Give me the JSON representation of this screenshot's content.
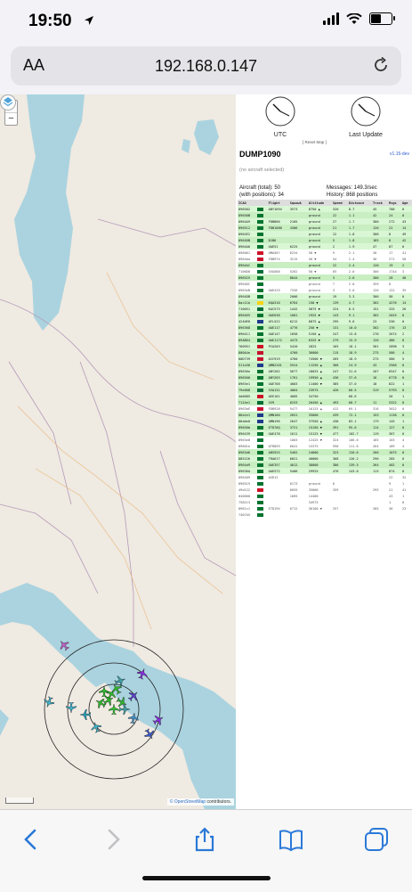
{
  "status_bar": {
    "time": "19:50",
    "battery_level": 0.6
  },
  "address_bar": {
    "aa_label": "AA",
    "url": "192.168.0.147"
  },
  "map": {
    "zoom_in": "+",
    "zoom_out": "−",
    "attribution_osm": "© OpenStreetMap",
    "attribution_rest": "contributors."
  },
  "panel": {
    "clock_utc_label": "UTC",
    "clock_last_update_label": "Last Update",
    "reset_map": "[ Reset Map ]",
    "title": "DUMP1090",
    "version": "v1.15-dev",
    "no_aircraft_selected": "(no aircraft selected)",
    "stats": {
      "aircraft_total": "Aircraft (total): 50",
      "messages": "Messages: 149.3/sec",
      "with_positions": "(with positions): 34",
      "history": "History: 868 positions"
    }
  },
  "table": {
    "headers": [
      "ICAO",
      "",
      "Flight",
      "Squawk",
      "Altitude",
      "Speed",
      "Distance",
      "Track",
      "Msgs",
      "Age"
    ],
    "flag_colors": [
      "#006c35",
      "#ce1126",
      "#00732f",
      "#c8102e",
      "#f7d417",
      "#1e3a8a"
    ],
    "rows": [
      {
        "icao": "896502",
        "flag": 2,
        "flight": "ABY1694",
        "squawk": "3573",
        "alt": "8750 ▲",
        "spd": "320",
        "dist": "8.7",
        "trk": "45",
        "msgs": "788",
        "age": "0",
        "pos": true
      },
      {
        "icao": "89650B",
        "flag": 2,
        "flight": "",
        "squawk": "",
        "alt": "ground",
        "spd": "22",
        "dist": "1.1",
        "trk": "42",
        "msgs": "24",
        "age": "0",
        "pos": true
      },
      {
        "icao": "8964A9",
        "flag": 2,
        "flight": "FDB866",
        "squawk": "2105",
        "alt": "ground",
        "spd": "27",
        "dist": "1.7",
        "trk": "300",
        "msgs": "272",
        "age": "43",
        "pos": true
      },
      {
        "icao": "896512",
        "flag": 2,
        "flight": "FDB1080",
        "squawk": "4306",
        "alt": "ground",
        "spd": "21",
        "dist": "1.7",
        "trk": "120",
        "msgs": "22",
        "age": "14",
        "pos": true
      },
      {
        "icao": "8964E2",
        "flag": 2,
        "flight": "",
        "squawk": "",
        "alt": "ground",
        "spd": "12",
        "dist": "1.8",
        "trk": "308",
        "msgs": "8",
        "age": "49",
        "pos": true
      },
      {
        "icao": "8964DB",
        "flag": 2,
        "flight": "BJ86",
        "squawk": "",
        "alt": "ground",
        "spd": "5",
        "dist": "1.8",
        "trk": "185",
        "msgs": "8",
        "age": "42",
        "pos": true
      },
      {
        "icao": "8964A6",
        "flag": 2,
        "flight": "UAE51",
        "squawk": "6225",
        "alt": "ground",
        "spd": "2",
        "dist": "1.9",
        "trk": "47",
        "msgs": "87",
        "age": "0",
        "pos": true
      },
      {
        "icao": "896061",
        "flag": 1,
        "flight": "OMA507",
        "squawk": "6234",
        "alt": "50 ▼",
        "spd": "9",
        "dist": "2.1",
        "trk": "30",
        "msgs": "17",
        "age": "41",
        "pos": false
      },
      {
        "icao": "8964ba",
        "flag": 3,
        "flight": "FDB974",
        "squawk": "3215",
        "alt": "50 ▼",
        "spd": "54",
        "dist": "2.4",
        "trk": "30",
        "msgs": "271",
        "age": "58",
        "pos": false
      },
      {
        "icao": "8964AC",
        "flag": 2,
        "flight": "",
        "squawk": "",
        "alt": "ground",
        "spd": "22",
        "dist": "2.4",
        "trk": "120",
        "msgs": "19",
        "age": "2",
        "pos": true
      },
      {
        "icao": "7106D8",
        "flag": 0,
        "flight": "SVA568",
        "squawk": "5262",
        "alt": "50 ▼",
        "spd": "65",
        "dist": "2.6",
        "trk": "300",
        "msgs": "1744",
        "age": "3",
        "pos": false
      },
      {
        "icao": "896525",
        "flag": 2,
        "flight": "",
        "squawk": "8044",
        "alt": "ground",
        "spd": "3",
        "dist": "2.6",
        "trk": "300",
        "msgs": "28",
        "age": "48",
        "pos": true
      },
      {
        "icao": "8964DC",
        "flag": 2,
        "flight": "",
        "squawk": "",
        "alt": "ground",
        "spd": "7",
        "dist": "2.8",
        "trk": "359",
        "msgs": "8",
        "age": "",
        "pos": false
      },
      {
        "icao": "8963eB",
        "flag": 2,
        "flight": "UAE419",
        "squawk": "7336",
        "alt": "ground",
        "spd": "3",
        "dist": "3.0",
        "trk": "120",
        "msgs": "122",
        "age": "35",
        "pos": false
      },
      {
        "icao": "8964DB",
        "flag": 2,
        "flight": "",
        "squawk": "2006",
        "alt": "ground",
        "spd": "19",
        "dist": "3.3",
        "trk": "300",
        "msgs": "58",
        "age": "0",
        "pos": true
      },
      {
        "icao": "8ac11b",
        "flag": 4,
        "flight": "KQA310",
        "squawk": "6764",
        "alt": "150 ▼",
        "spd": "139",
        "dist": "4.7",
        "trk": "302",
        "msgs": "4276",
        "age": "14",
        "pos": true
      },
      {
        "icao": "710051",
        "flag": 0,
        "flight": "KAC573",
        "squawk": "1442",
        "alt": "5875 ▼",
        "spd": "224",
        "dist": "8.5",
        "trk": "151",
        "msgs": "325",
        "age": "26",
        "pos": true
      },
      {
        "icao": "8964D5",
        "flag": 2,
        "flight": "UAE638",
        "squawk": "1001",
        "alt": "1925 ▼",
        "spd": "143",
        "dist": "9.1",
        "trk": "302",
        "msgs": "2025",
        "age": "0",
        "pos": true
      },
      {
        "icao": "4240E8",
        "flag": 5,
        "flight": "AFL522",
        "squawk": "6212",
        "alt": "6875 ▲",
        "spd": "295",
        "dist": "9.6",
        "trk": "23",
        "msgs": "536",
        "age": "0",
        "pos": true
      },
      {
        "icao": "89636D",
        "flag": 2,
        "flight": "UAE117",
        "squawk": "4776",
        "alt": "250 ▼",
        "spd": "131",
        "dist": "10.0",
        "trk": "302",
        "msgs": "176",
        "age": "13",
        "pos": true
      },
      {
        "icao": "896411",
        "flag": 2,
        "flight": "UAE147",
        "squawk": "1658",
        "alt": "5150 ▲",
        "spd": "247",
        "dist": "13.8",
        "trk": "270",
        "msgs": "2674",
        "age": "2",
        "pos": true
      },
      {
        "icao": "89ABD4",
        "flag": 2,
        "flight": "UAE1172",
        "squawk": "4473",
        "alt": "6325 ▼",
        "spd": "279",
        "dist": "15.9",
        "trk": "120",
        "msgs": "486",
        "age": "0",
        "pos": true
      },
      {
        "icao": "760951",
        "flag": 1,
        "flight": "PIA203",
        "squawk": "5420",
        "alt": "2825",
        "spd": "165",
        "dist": "18.1",
        "trk": "301",
        "msgs": "2898",
        "age": "3",
        "pos": true
      },
      {
        "icao": "800A4e",
        "flag": 3,
        "flight": "",
        "squawk": "4760",
        "alt": "36000",
        "spd": "115",
        "dist": "18.9",
        "trk": "275",
        "msgs": "586",
        "age": "4",
        "pos": true
      },
      {
        "icao": "80D739",
        "flag": 3,
        "flight": "AIC919",
        "squawk": "4760",
        "alt": "74500 ▼",
        "spd": "265",
        "dist": "18.9",
        "trk": "275",
        "msgs": "586",
        "age": "5",
        "pos": true
      },
      {
        "icao": "511a30",
        "flag": 5,
        "flight": "QMN2201",
        "squawk": "5524",
        "alt": "11250 ▲",
        "spd": "368",
        "dist": "24.9",
        "trk": "43",
        "msgs": "2566",
        "age": "0",
        "pos": true
      },
      {
        "icao": "89636e",
        "flag": 2,
        "flight": "ABY202",
        "squawk": "5677",
        "alt": "18025 ▲",
        "spd": "247",
        "dist": "31.6",
        "trk": "207",
        "msgs": "6547",
        "age": "0",
        "pos": true
      },
      {
        "icao": "896500",
        "flag": 2,
        "flight": "ABY203",
        "squawk": "1761",
        "alt": "19950 ▲",
        "spd": "436",
        "dist": "37.6",
        "trk": "16",
        "msgs": "6778",
        "age": "0",
        "pos": true
      },
      {
        "icao": "8963e1",
        "flag": 2,
        "flight": "UAE768",
        "squawk": "4003",
        "alt": "11400 ▼",
        "spd": "385",
        "dist": "37.0",
        "trk": "18",
        "msgs": "822",
        "age": "1",
        "pos": true
      },
      {
        "icao": "79e008",
        "flag": 0,
        "flight": "SVA131",
        "squawk": "4064",
        "alt": "23975",
        "spd": "426",
        "dist": "60.5",
        "trk": "319",
        "msgs": "5793",
        "age": "0",
        "pos": true
      },
      {
        "icao": "4d0085",
        "flag": 1,
        "flight": "AEE101",
        "squawk": "4005",
        "alt": "34750",
        "spd": "",
        "dist": "68.6",
        "trk": "",
        "msgs": "26",
        "age": "1",
        "pos": true
      },
      {
        "icao": "7124e1",
        "flag": 0,
        "flight": "SV9",
        "squawk": "6253",
        "alt": "20450 ▲",
        "spd": "493",
        "dist": "68.7",
        "trk": "11",
        "msgs": "5322",
        "age": "0",
        "pos": true
      },
      {
        "icao": "8963bE",
        "flag": 3,
        "flight": "FDB928",
        "squawk": "5477",
        "alt": "16125 ▲",
        "spd": "412",
        "dist": "69.1",
        "trk": "316",
        "msgs": "3022",
        "age": "0",
        "pos": false
      },
      {
        "icao": "06a1e1",
        "flag": 5,
        "flight": "QMN100",
        "squawk": "2651",
        "alt": "35000",
        "spd": "439",
        "dist": "72.1",
        "trk": "153",
        "msgs": "1136",
        "age": "0",
        "pos": true
      },
      {
        "icao": "06a0e0",
        "flag": 5,
        "flight": "QMN196",
        "squawk": "2647",
        "alt": "37550 ▲",
        "spd": "438",
        "dist": "83.1",
        "trk": "179",
        "msgs": "145",
        "age": "1",
        "pos": true
      },
      {
        "icao": "89650b",
        "flag": 2,
        "flight": "ETD70Q",
        "squawk": "3721",
        "alt": "15150 ▼",
        "spd": "391",
        "dist": "95.6",
        "trk": "114",
        "msgs": "127",
        "age": "0",
        "pos": true
      },
      {
        "icao": "896439",
        "flag": 2,
        "flight": "UAE478",
        "squawk": "1611",
        "alt": "15125 ▼",
        "spd": "477",
        "dist": "102.7",
        "trk": "119",
        "msgs": "367",
        "age": "0",
        "pos": true
      },
      {
        "icao": "8963e8",
        "flag": 2,
        "flight": "",
        "squawk": "1003",
        "alt": "12425 ▼",
        "spd": "324",
        "dist": "106.6",
        "trk": "165",
        "msgs": "103",
        "age": "4",
        "pos": false
      },
      {
        "icao": "89601e",
        "flag": 2,
        "flight": "QTR859",
        "squawk": "6041",
        "alt": "15375",
        "spd": "590",
        "dist": "111.6",
        "trk": "264",
        "msgs": "189",
        "age": "4",
        "pos": false
      },
      {
        "icao": "8963d6",
        "flag": 2,
        "flight": "ABS925",
        "squawk": "5462",
        "alt": "24000",
        "spd": "323",
        "dist": "120.6",
        "trk": "260",
        "msgs": "1075",
        "age": "0",
        "pos": true
      },
      {
        "icao": "885226",
        "flag": 2,
        "flight": "TRA617",
        "squawk": "6021",
        "alt": "40000",
        "spd": "368",
        "dist": "126.2",
        "trk": "290",
        "msgs": "285",
        "age": "0",
        "pos": true
      },
      {
        "icao": "8964d9",
        "flag": 2,
        "flight": "UAE357",
        "squawk": "4012",
        "alt": "38000",
        "spd": "386",
        "dist": "139.5",
        "trk": "264",
        "msgs": "402",
        "age": "0",
        "pos": true
      },
      {
        "icao": "89636A",
        "flag": 2,
        "flight": "UAE572",
        "squawk": "5406",
        "alt": "29925",
        "spd": "476",
        "dist": "143.0",
        "trk": "113",
        "msgs": "874",
        "age": "0",
        "pos": true
      },
      {
        "icao": "896409",
        "flag": 2,
        "flight": "ASR12",
        "squawk": "",
        "alt": "",
        "spd": "",
        "dist": "",
        "trk": "",
        "msgs": "22",
        "age": "32",
        "pos": false
      },
      {
        "icao": "896519",
        "flag": 2,
        "flight": "",
        "squawk": "0173",
        "alt": "ground",
        "spd": "0",
        "dist": "",
        "trk": "",
        "msgs": "9",
        "age": "1",
        "pos": false
      },
      {
        "icao": "49d122",
        "flag": 1,
        "flight": "",
        "squawk": "6055",
        "alt": "35000",
        "spd": "359",
        "dist": "",
        "trk": "295",
        "msgs": "21",
        "age": "41",
        "pos": false
      },
      {
        "icao": "040000",
        "flag": 2,
        "flight": "",
        "squawk": "1665",
        "alt": "14400",
        "spd": "",
        "dist": "",
        "trk": "",
        "msgs": "43",
        "age": "1",
        "pos": false
      },
      {
        "icao": "758213",
        "flag": 2,
        "flight": "",
        "squawk": "",
        "alt": "34975",
        "spd": "",
        "dist": "",
        "trk": "",
        "msgs": "1",
        "age": "0",
        "pos": false
      },
      {
        "icao": "8961c1",
        "flag": 2,
        "flight": "ETD19V",
        "squawk": "6712",
        "alt": "36100 ▼",
        "spd": "257",
        "dist": "",
        "trk": "285",
        "msgs": "36",
        "age": "23",
        "pos": false
      },
      {
        "icao": "7407A5",
        "flag": 2,
        "flight": "",
        "squawk": "",
        "alt": "",
        "spd": "",
        "dist": "",
        "trk": "",
        "msgs": "",
        "age": "",
        "pos": false
      }
    ]
  }
}
